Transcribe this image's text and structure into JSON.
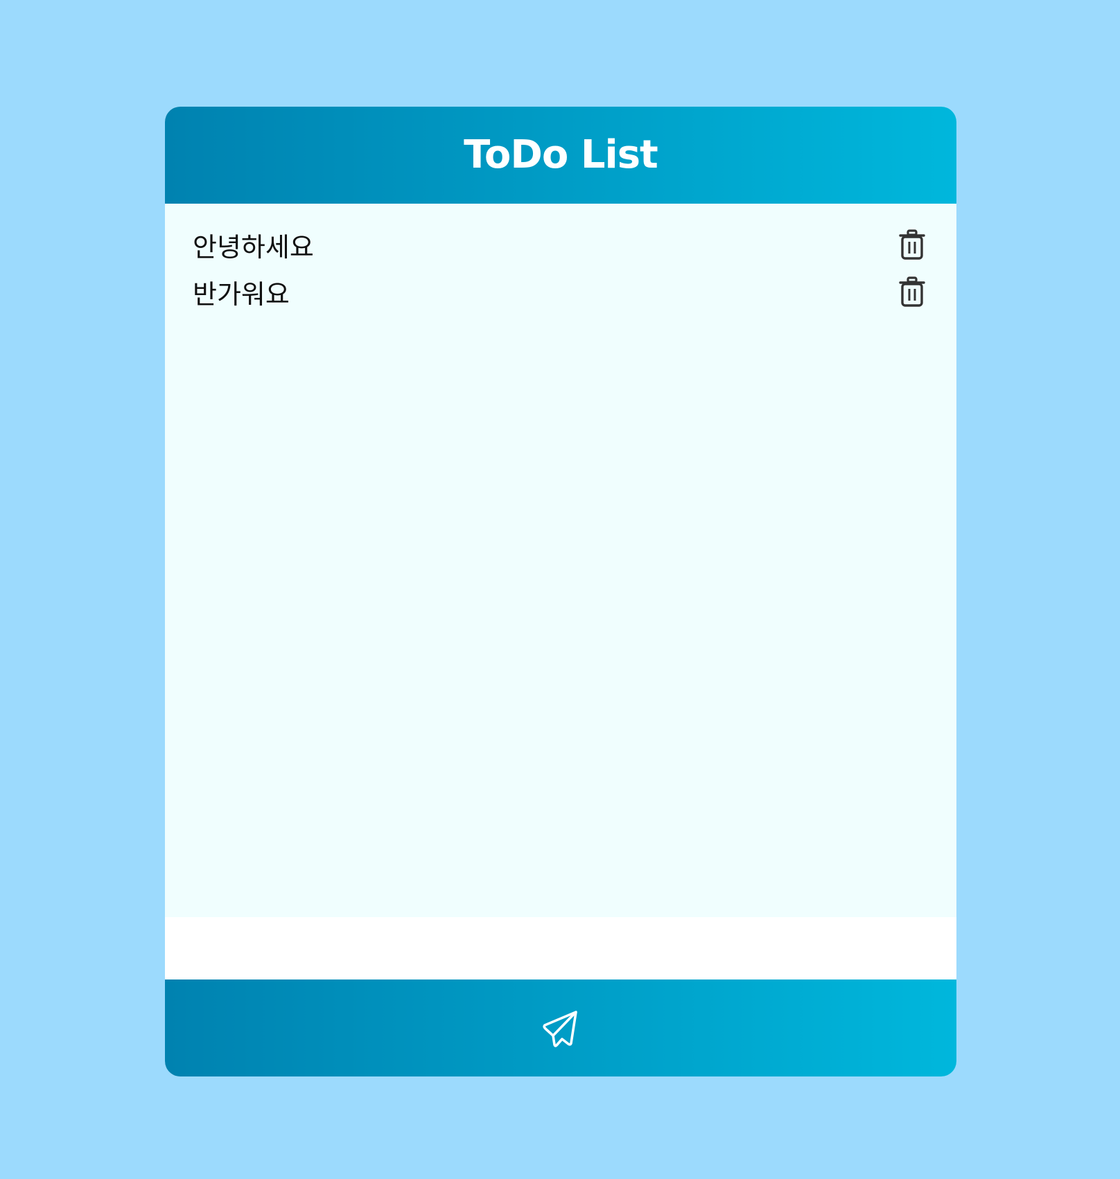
{
  "header": {
    "title": "ToDo List"
  },
  "todos": [
    {
      "text": "안녕하세요",
      "action_icon": "trash-icon"
    },
    {
      "text": "반가워요",
      "action_icon": "trash-icon"
    }
  ],
  "footer": {
    "submit_icon": "paper-plane-send-icon"
  },
  "colors": {
    "page_background": "#9cdafd",
    "gradient_start": "#0082b0",
    "gradient_end": "#00b7dc",
    "list_background": "#f0fefe",
    "icon_color": "#333333"
  }
}
